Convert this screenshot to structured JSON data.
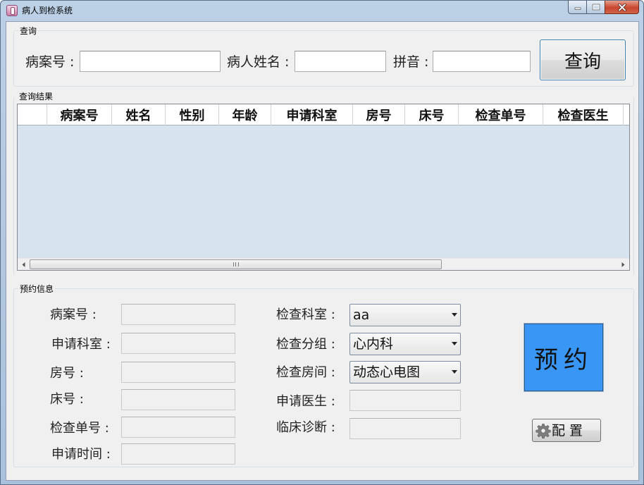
{
  "window": {
    "title": "病人到检系统"
  },
  "query": {
    "group_title": "查询",
    "case_no_label": "病案号 :",
    "name_label": "病人姓名 :",
    "pinyin_label": "拼音 :",
    "case_no_value": "",
    "name_value": "",
    "pinyin_value": "",
    "query_button": "查询"
  },
  "results": {
    "group_title": "查询结果",
    "columns": [
      "病案号",
      "姓名",
      "性别",
      "年龄",
      "申请科室",
      "房号",
      "床号",
      "检查单号",
      "检查医生"
    ],
    "rows": []
  },
  "reservation": {
    "group_title": "预约信息",
    "case_no_label": "病案号 :",
    "apply_dept_label": "申请科室 :",
    "room_no_label": "房号 :",
    "bed_no_label": "床号 :",
    "exam_order_label": "检查单号 :",
    "apply_time_label": "申请时间 :",
    "exam_dept_label": "检查科室 :",
    "exam_group_label": "检查分组 :",
    "exam_room_label": "检查房间 :",
    "apply_doctor_label": "申请医生 :",
    "clinical_diag_label": "临床诊断 :",
    "case_no_value": "",
    "apply_dept_value": "",
    "room_no_value": "",
    "bed_no_value": "",
    "exam_order_value": "",
    "apply_time_value": "",
    "apply_doctor_value": "",
    "clinical_diag_value": "",
    "exam_dept_selected": "aa",
    "exam_group_selected": "心内科",
    "exam_room_selected": "动态心电图",
    "reserve_button": "预约",
    "config_button": "配 置"
  },
  "colors": {
    "reserve_button": "#3996f5",
    "grid_background": "#d7e3ef",
    "close_button": "#c8462f"
  },
  "icons": {
    "app": "app-icon",
    "config": "gear-icon",
    "minimize": "minimize-icon",
    "maximize": "maximize-icon",
    "close": "close-icon"
  }
}
